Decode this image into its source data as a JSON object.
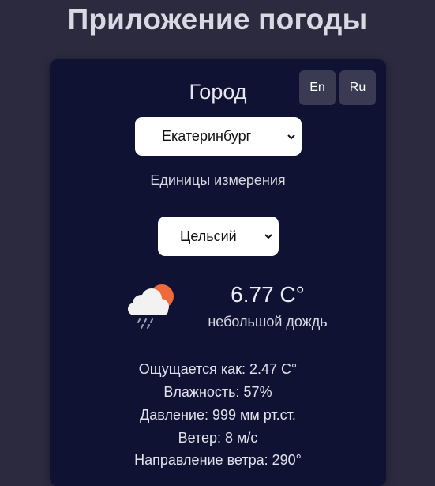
{
  "app": {
    "title": "Приложение погоды"
  },
  "language": {
    "en_label": "En",
    "ru_label": "Ru"
  },
  "city": {
    "label": "Город",
    "selected": "Екатеринбург"
  },
  "units": {
    "label": "Единицы измерения",
    "selected": "Цельсий"
  },
  "weather": {
    "icon": "cloud-sun-rain-icon",
    "temperature": "6.77 C°",
    "description": "небольшой дождь"
  },
  "details": {
    "feels_like": "Ощущается как: 2.47 C°",
    "humidity": "Влажность: 57%",
    "pressure": "Давление: 999 мм рт.ст.",
    "wind": "Ветер: 8 м/с",
    "wind_direction": "Направление ветра: 290°"
  },
  "colors": {
    "page_background": "#2b2a3f",
    "card_background": "#101233",
    "button_background": "#3a3a52",
    "sun": "#ef6a3a"
  }
}
